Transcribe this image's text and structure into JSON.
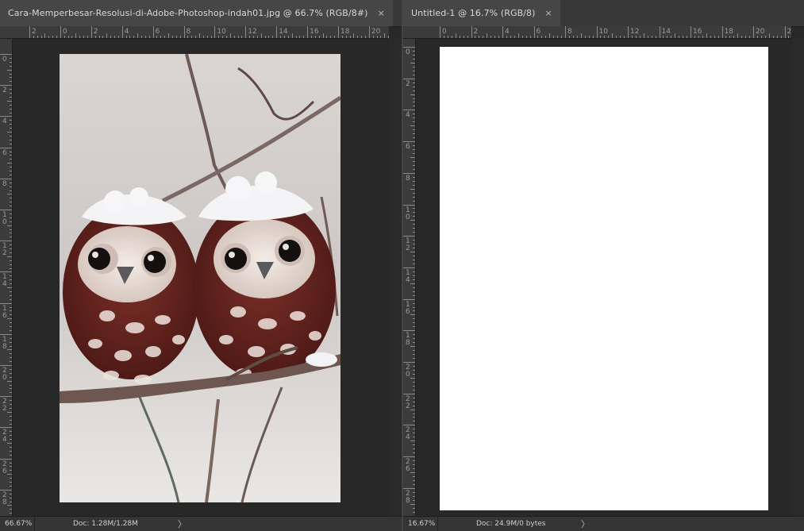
{
  "left_document": {
    "tab_title": "Cara-Memperbesar-Resolusi-di-Adobe-Photoshop-indah01.jpg @ 66.7% (RGB/8#)",
    "close_glyph": "×",
    "ruler_h_labels": [
      "2",
      "0",
      "2",
      "4",
      "6",
      "8",
      "10",
      "12",
      "14",
      "16",
      "18",
      "20"
    ],
    "ruler_v_labels": [
      "0",
      "2",
      "4",
      "6",
      "8",
      "1\n0",
      "1\n2",
      "1\n4",
      "1\n6",
      "1\n8",
      "2\n0",
      "2\n2",
      "2\n4",
      "2\n6",
      "2\n8",
      "3"
    ],
    "status": {
      "zoom": "66.67%",
      "doc": "Doc: 1.28M/1.28M",
      "arrow": "〉"
    },
    "image_subject": "two-owls-photo"
  },
  "right_document": {
    "tab_title": "Untitled-1 @ 16.7% (RGB/8)",
    "close_glyph": "×",
    "ruler_h_labels": [
      "0",
      "2",
      "4",
      "6",
      "8",
      "10",
      "12",
      "14",
      "16",
      "18",
      "20",
      "2"
    ],
    "ruler_v_labels": [
      "0",
      "2",
      "4",
      "6",
      "8",
      "1\n0",
      "1\n2",
      "1\n4",
      "1\n6",
      "1\n8",
      "2\n0",
      "2\n2",
      "2\n4",
      "2\n6",
      "2\n8"
    ],
    "status": {
      "zoom": "16.67%",
      "doc": "Doc: 24.9M/0 bytes",
      "arrow": "〉"
    }
  },
  "colors": {
    "app_bg": "#282828",
    "tab_active": "#464646",
    "ruler": "#3b3b3b",
    "canvas_white": "#ffffff"
  }
}
